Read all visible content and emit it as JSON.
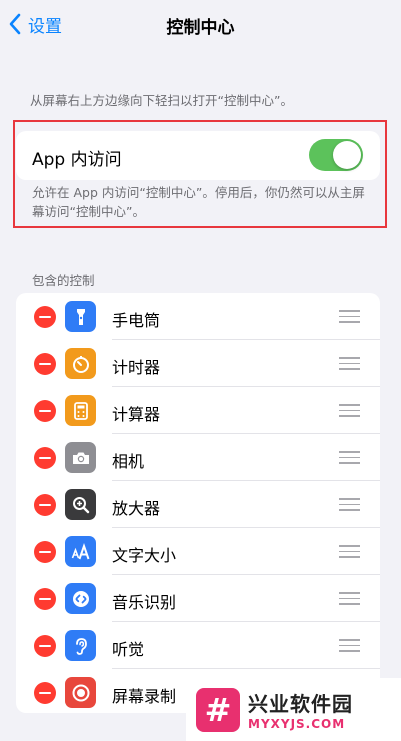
{
  "nav": {
    "back_label": "设置",
    "title": "控制中心"
  },
  "hint": "从屏幕右上方边缘向下轻扫以打开“控制中心”。",
  "toggle": {
    "label": "App 内访问",
    "on": true,
    "footer": "允许在 App 内访问“控制中心”。停用后，你仍然可以从主屏幕访问“控制中心”。"
  },
  "section_header": "包含的控制",
  "controls": [
    {
      "label": "手电筒",
      "icon": "flashlight-icon",
      "color": "#2f7cf6"
    },
    {
      "label": "计时器",
      "icon": "timer-icon",
      "color": "#f29a1c"
    },
    {
      "label": "计算器",
      "icon": "calculator-icon",
      "color": "#f29a1c"
    },
    {
      "label": "相机",
      "icon": "camera-icon",
      "color": "#8e8e93"
    },
    {
      "label": "放大器",
      "icon": "magnifier-icon",
      "color": "#3a3a3c"
    },
    {
      "label": "文字大小",
      "icon": "text-size-icon",
      "color": "#2f7cf6"
    },
    {
      "label": "音乐识别",
      "icon": "shazam-icon",
      "color": "#2f7cf6"
    },
    {
      "label": "听觉",
      "icon": "ear-icon",
      "color": "#2f7cf6"
    },
    {
      "label": "屏幕录制",
      "icon": "screen-record-icon",
      "color": "#e8473c"
    }
  ],
  "watermark": {
    "cn": "兴业软件园",
    "en": "MYXYJS.COM",
    "mark": "#"
  },
  "colors": {
    "accent": "#0a84ff",
    "switch_on": "#5cc25b",
    "remove": "#ff3b30",
    "highlight": "#e8373d"
  }
}
